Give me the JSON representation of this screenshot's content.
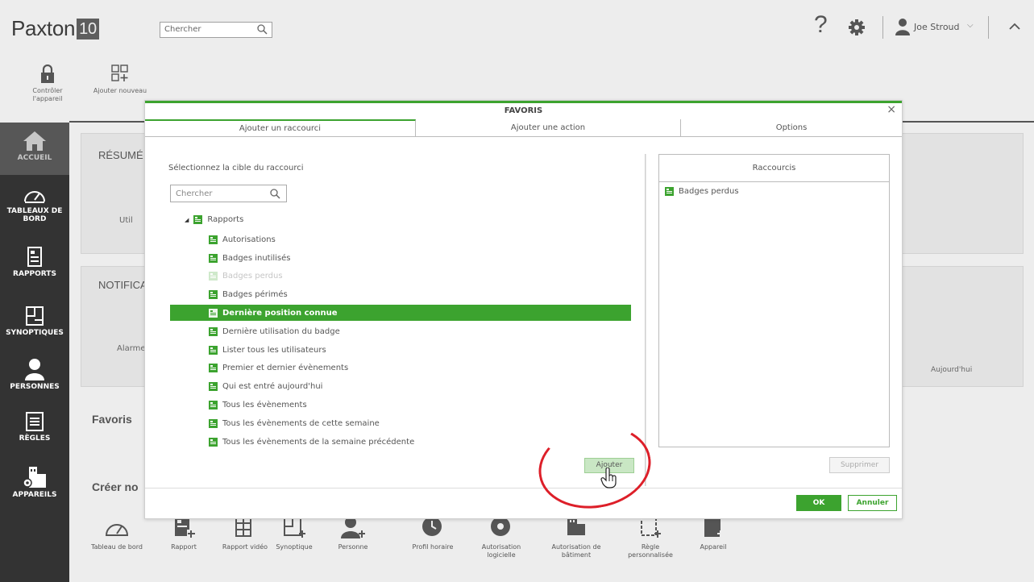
{
  "app": {
    "logo_text": "Paxton",
    "logo_version": "10"
  },
  "header": {
    "search_placeholder": "Chercher",
    "help_label": "?",
    "user_name": "Joe Stroud",
    "user_menu_caret": "⌵"
  },
  "toolbar": {
    "control_device": "Contrôler l'appareil",
    "add_new": "Ajouter nouveau"
  },
  "sidebar": {
    "items": [
      {
        "label": "ACCUEIL",
        "icon": "home-icon",
        "active": true
      },
      {
        "label": "TABLEAUX DE BORD",
        "icon": "gauge-icon"
      },
      {
        "label": "RAPPORTS",
        "icon": "report-icon"
      },
      {
        "label": "SYNOPTIQUES",
        "icon": "floorplan-icon"
      },
      {
        "label": "PERSONNES",
        "icon": "person-icon"
      },
      {
        "label": "RÈGLES",
        "icon": "rules-icon"
      },
      {
        "label": "APPAREILS",
        "icon": "devices-icon"
      }
    ]
  },
  "background": {
    "summary_title": "RÉSUMÉ",
    "summary_text": "Util",
    "notif_title": "NOTIFICA",
    "notif_text": "Alarme",
    "today": "Aujourd'hui",
    "favorites": "Favoris",
    "create": "Créer no",
    "create_items": [
      {
        "label": "Tableau de bord",
        "icon": "gauge-icon"
      },
      {
        "label": "Rapport",
        "icon": "report-add-icon"
      },
      {
        "label": "Rapport vidéo",
        "icon": "video-report-icon"
      },
      {
        "label": "Synoptique",
        "icon": "floorplan-add-icon"
      },
      {
        "label": "Personne",
        "icon": "person-add-icon"
      },
      {
        "label": "Profil horaire",
        "icon": "clock-icon"
      },
      {
        "label": "Autorisation logicielle",
        "icon": "software-auth-icon"
      },
      {
        "label": "Autorisation de bâtiment",
        "icon": "building-auth-icon"
      },
      {
        "label": "Règle personnalisée",
        "icon": "custom-rule-icon"
      },
      {
        "label": "Appareil",
        "icon": "device-add-icon"
      }
    ]
  },
  "modal": {
    "title": "FAVORIS",
    "close": "×",
    "tabs": [
      "Ajouter un raccourci",
      "Ajouter une action",
      "Options"
    ],
    "prompt": "Sélectionnez la cible du raccourci",
    "search_placeholder": "Chercher",
    "tree_root": "Rapports",
    "tree_items": [
      {
        "label": "Autorisations",
        "state": "normal"
      },
      {
        "label": "Badges inutilisés",
        "state": "normal"
      },
      {
        "label": "Badges perdus",
        "state": "disabled"
      },
      {
        "label": "Badges périmés",
        "state": "normal"
      },
      {
        "label": "Dernière position connue",
        "state": "selected"
      },
      {
        "label": "Dernière utilisation du badge",
        "state": "normal"
      },
      {
        "label": "Lister tous les utilisateurs",
        "state": "normal"
      },
      {
        "label": "Premier et dernier évènements",
        "state": "normal"
      },
      {
        "label": "Qui est entré aujourd'hui",
        "state": "normal"
      },
      {
        "label": "Tous les évènements",
        "state": "normal"
      },
      {
        "label": "Tous les évènements de cette semaine",
        "state": "normal"
      },
      {
        "label": "Tous les évènements de la semaine précédente",
        "state": "normal"
      }
    ],
    "shortcuts_header": "Raccourcis",
    "shortcuts": [
      "Badges perdus"
    ],
    "add_button": "Ajouter",
    "delete_button": "Supprimer",
    "ok_button": "OK",
    "cancel_button": "Annuler"
  },
  "colors": {
    "accent": "#3ca32f",
    "sidebar": "#333333",
    "annotation": "#dd1f29"
  }
}
